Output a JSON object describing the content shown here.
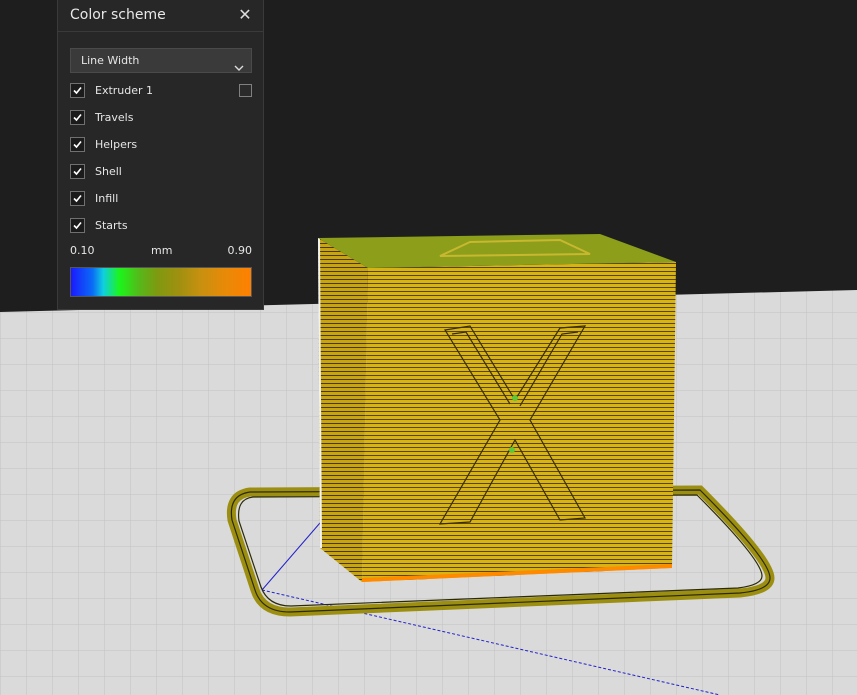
{
  "panel": {
    "title": "Color scheme",
    "close_glyph": "✕",
    "close_icon": "close-icon",
    "dropdown": {
      "selected": "Line Width",
      "icon": "chevron-down-icon"
    },
    "checkboxes": [
      {
        "id": "extruder-1",
        "label": "Extruder 1",
        "checked": true,
        "has_swatch": true
      },
      {
        "id": "travels",
        "label": "Travels",
        "checked": true
      },
      {
        "id": "helpers",
        "label": "Helpers",
        "checked": true
      },
      {
        "id": "shell",
        "label": "Shell",
        "checked": true
      },
      {
        "id": "infill",
        "label": "Infill",
        "checked": true
      },
      {
        "id": "starts",
        "label": "Starts",
        "checked": true
      }
    ],
    "range": {
      "min": "0.10",
      "unit": "mm",
      "max": "0.90"
    },
    "gradient_colors": [
      "#1a1aff",
      "#1cf51a",
      "#7f9910",
      "#ff8000"
    ]
  },
  "colors": {
    "background": "#1e1e1e",
    "build_plate": "#d9d9d9",
    "model_yellow": "#d4ac10",
    "model_top_green": "#8c9e1a",
    "skirt": "#a89a10",
    "travel_line": "#2222cc"
  }
}
